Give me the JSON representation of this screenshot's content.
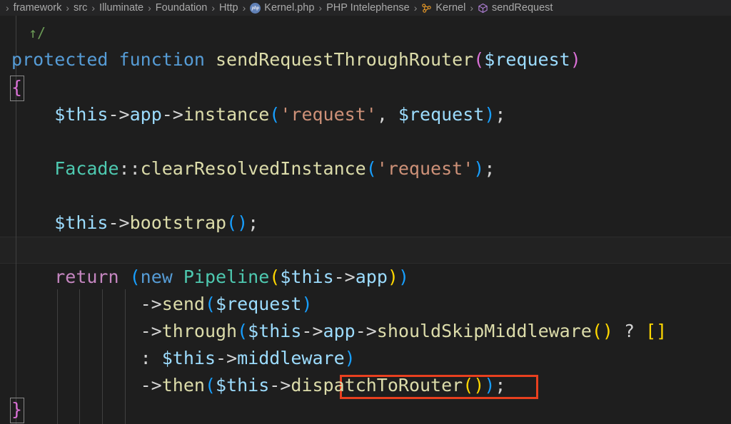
{
  "breadcrumb": {
    "items": [
      {
        "label": "framework",
        "icon": null
      },
      {
        "label": "src",
        "icon": null
      },
      {
        "label": "Illuminate",
        "icon": null
      },
      {
        "label": "Foundation",
        "icon": null
      },
      {
        "label": "Http",
        "icon": null
      },
      {
        "label": "Kernel.php",
        "icon": "php-file-icon"
      },
      {
        "label": "PHP Intelephense",
        "icon": null
      },
      {
        "label": "Kernel",
        "icon": "class-symbol-icon"
      },
      {
        "label": "sendRequest",
        "icon": "method-symbol-icon"
      }
    ],
    "separator": "›"
  },
  "editor": {
    "language": "php",
    "lines": [
      {
        "id": "l1",
        "text": "    ↑/"
      },
      {
        "id": "l2",
        "text": "protected function sendRequestThroughRouter($request)"
      },
      {
        "id": "l3",
        "text": "{"
      },
      {
        "id": "l4",
        "text": "    $this->app->instance('request', $request);"
      },
      {
        "id": "l5",
        "text": ""
      },
      {
        "id": "l6",
        "text": "    Facade::clearResolvedInstance('request');"
      },
      {
        "id": "l7",
        "text": ""
      },
      {
        "id": "l8",
        "text": "    $this->bootstrap();"
      },
      {
        "id": "l9",
        "text": ""
      },
      {
        "id": "l10",
        "text": "    return (new Pipeline($this->app))"
      },
      {
        "id": "l11",
        "text": "                ->send($request)"
      },
      {
        "id": "l12",
        "text": "                ->through($this->app->shouldSkipMiddleware() ? []"
      },
      {
        "id": "l13",
        "text": "                : $this->middleware)"
      },
      {
        "id": "l14",
        "text": "                ->then($this->dispatchToRouter());"
      },
      {
        "id": "l15",
        "text": "}"
      }
    ]
  },
  "annotation": {
    "highlighted_text": "dispatchToRouter()",
    "color": "#e8401f"
  },
  "theme": {
    "background": "#1e1e1e",
    "breadcrumb_background": "#252526",
    "foreground": "#d4d4d4",
    "keyword": "#569cd6",
    "control_keyword": "#c586c0",
    "function": "#dcdcaa",
    "variable": "#9cdcfe",
    "type": "#4ec9b0",
    "string": "#ce9178",
    "comment": "#6a9955",
    "bracket_level_1": "#ffd700",
    "bracket_level_2": "#da70d6",
    "bracket_level_3": "#179fff",
    "current_line": "#222222"
  }
}
